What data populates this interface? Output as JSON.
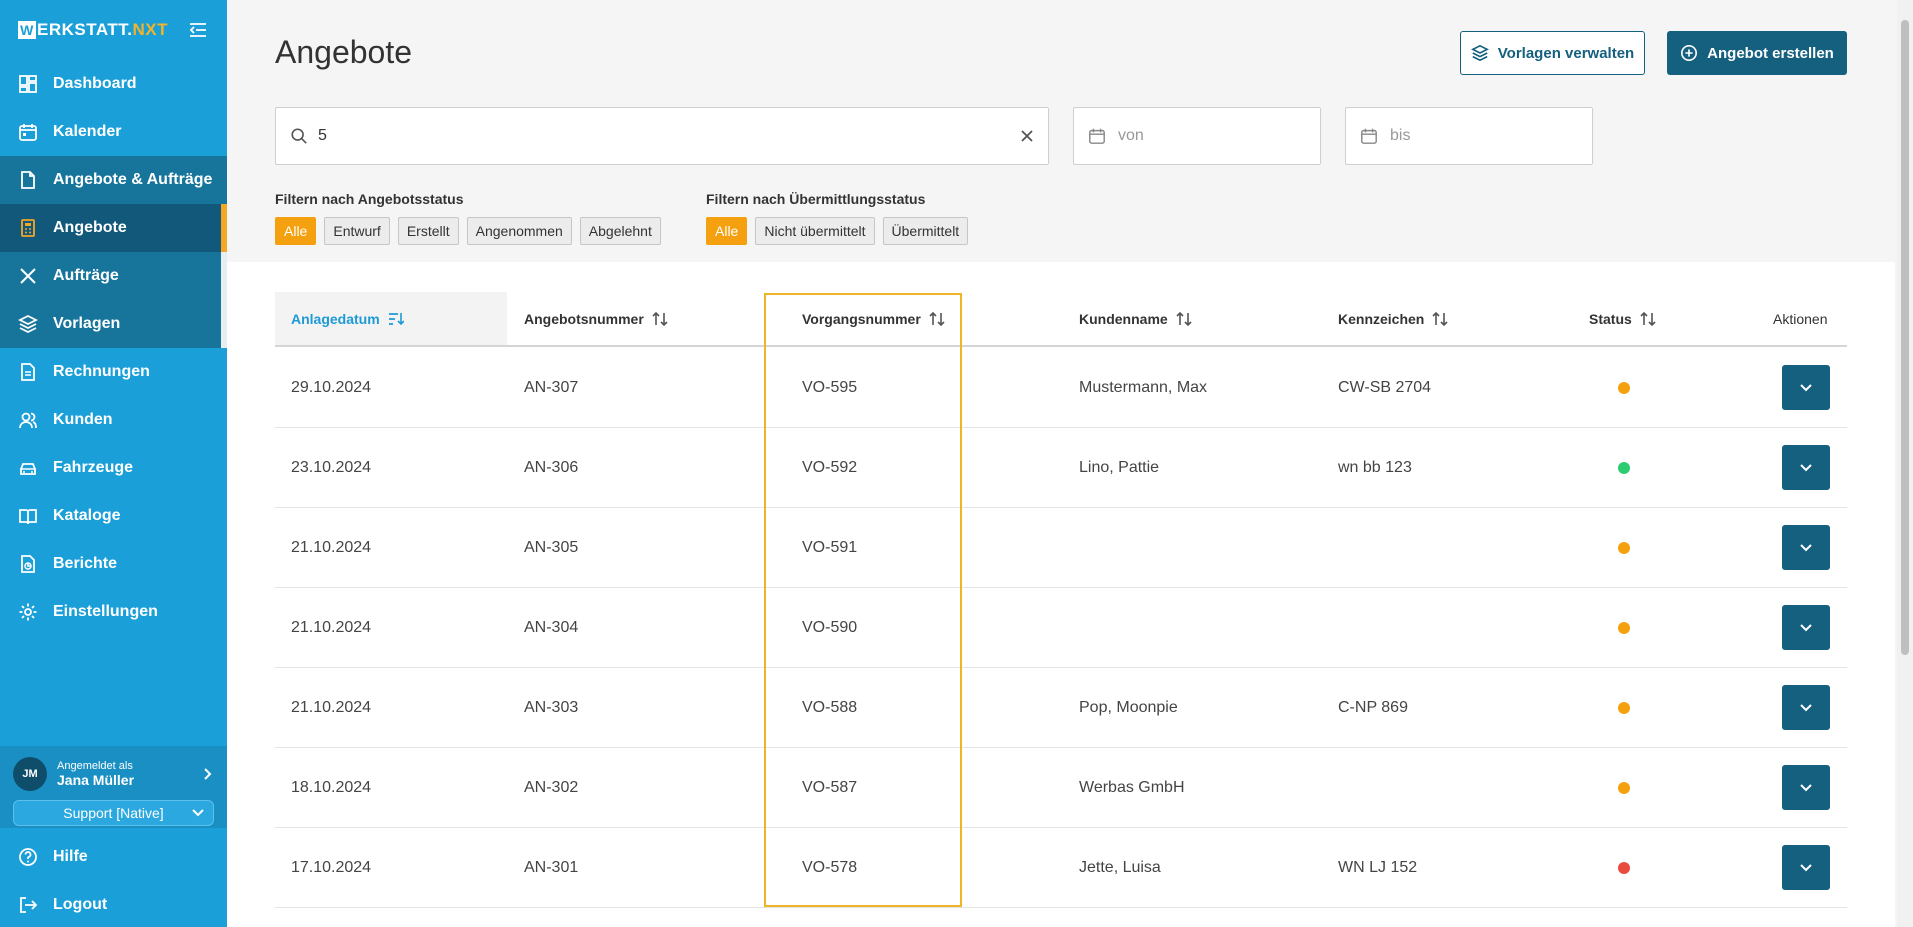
{
  "sidebar": {
    "logo_w": "W",
    "logo_rest": "ERKSTATT.",
    "logo_nxt": "NXT",
    "items": [
      {
        "label": "Dashboard"
      },
      {
        "label": "Kalender"
      },
      {
        "label": "Angebote & Aufträge"
      },
      {
        "label": "Angebote"
      },
      {
        "label": "Aufträge"
      },
      {
        "label": "Vorlagen"
      },
      {
        "label": "Rechnungen"
      },
      {
        "label": "Kunden"
      },
      {
        "label": "Fahrzeuge"
      },
      {
        "label": "Kataloge"
      },
      {
        "label": "Berichte"
      },
      {
        "label": "Einstellungen"
      }
    ],
    "user": {
      "initials": "JM",
      "logged_in_as": "Angemeldet als",
      "name": "Jana Müller",
      "tenant": "Support [Native]"
    },
    "help": "Hilfe",
    "logout": "Logout"
  },
  "header": {
    "title": "Angebote",
    "manage_templates": "Vorlagen verwalten",
    "create_offer": "Angebot erstellen"
  },
  "filters": {
    "search_value": "5",
    "from_placeholder": "von",
    "to_placeholder": "bis",
    "offer_status_label": "Filtern nach Angebotsstatus",
    "offer_status_options": [
      "Alle",
      "Entwurf",
      "Erstellt",
      "Angenommen",
      "Abgelehnt"
    ],
    "transmission_label": "Filtern nach Übermittlungsstatus",
    "transmission_options": [
      "Alle",
      "Nicht übermittelt",
      "Übermittelt"
    ]
  },
  "table": {
    "columns": [
      "Anlagedatum",
      "Angebotsnummer",
      "Vorgangsnummer",
      "Kundenname",
      "Kennzeichen",
      "Status",
      "Aktionen"
    ],
    "rows": [
      {
        "date": "29.10.2024",
        "offer": "AN-307",
        "process": "VO-595",
        "customer": "Mustermann, Max",
        "plate": "CW-SB 2704",
        "status_color": "#f5a00f"
      },
      {
        "date": "23.10.2024",
        "offer": "AN-306",
        "process": "VO-592",
        "customer": "Lino, Pattie",
        "plate": "wn bb 123",
        "status_color": "#2ecc71"
      },
      {
        "date": "21.10.2024",
        "offer": "AN-305",
        "process": "VO-591",
        "customer": "",
        "plate": "",
        "status_color": "#f5a00f"
      },
      {
        "date": "21.10.2024",
        "offer": "AN-304",
        "process": "VO-590",
        "customer": "",
        "plate": "",
        "status_color": "#f5a00f"
      },
      {
        "date": "21.10.2024",
        "offer": "AN-303",
        "process": "VO-588",
        "customer": "Pop, Moonpie",
        "plate": "C-NP 869",
        "status_color": "#f5a00f"
      },
      {
        "date": "18.10.2024",
        "offer": "AN-302",
        "process": "VO-587",
        "customer": "Werbas GmbH",
        "plate": "",
        "status_color": "#f5a00f"
      },
      {
        "date": "17.10.2024",
        "offer": "AN-301",
        "process": "VO-578",
        "customer": "Jette, Luisa",
        "plate": "WN LJ 152",
        "status_color": "#e74c3c"
      }
    ]
  },
  "colors": {
    "sidebar": "#1b9fd8",
    "primary": "#15607f",
    "accent": "#f5a00f"
  }
}
